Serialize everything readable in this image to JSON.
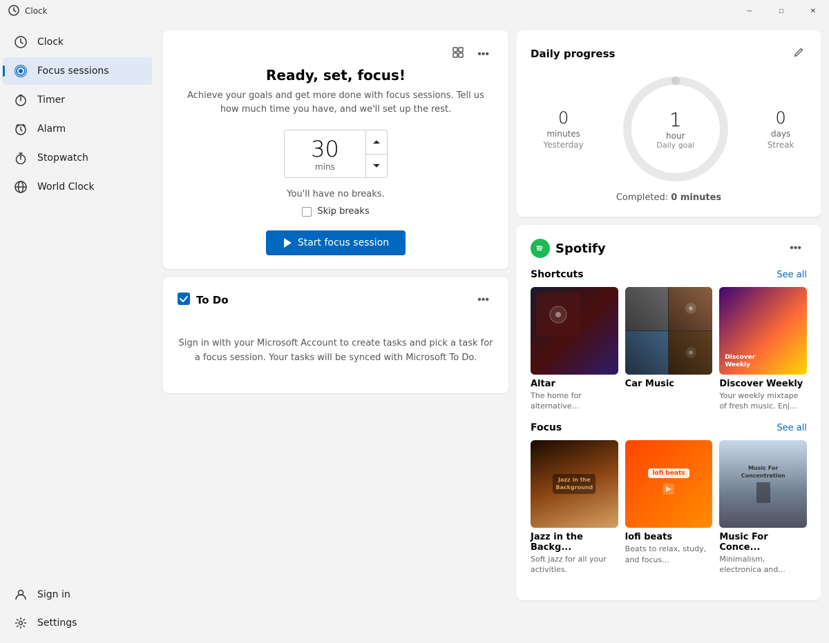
{
  "titlebar": {
    "title": "Clock",
    "minimize_label": "─",
    "maximize_label": "□",
    "close_label": "✕"
  },
  "sidebar": {
    "items": [
      {
        "id": "clock",
        "label": "Clock",
        "icon": "clock"
      },
      {
        "id": "focus",
        "label": "Focus sessions",
        "icon": "focus",
        "active": true
      },
      {
        "id": "timer",
        "label": "Timer",
        "icon": "timer"
      },
      {
        "id": "alarm",
        "label": "Alarm",
        "icon": "alarm"
      },
      {
        "id": "stopwatch",
        "label": "Stopwatch",
        "icon": "stopwatch"
      },
      {
        "id": "worldclock",
        "label": "World Clock",
        "icon": "world"
      }
    ],
    "bottom_items": [
      {
        "id": "signin",
        "label": "Sign in",
        "icon": "person"
      },
      {
        "id": "settings",
        "label": "Settings",
        "icon": "settings"
      }
    ]
  },
  "focus_card": {
    "title": "Ready, set, focus!",
    "subtitle": "Achieve your goals and get more done with focus sessions. Tell us how much time you have, and we'll set up the rest.",
    "time_value": "30",
    "time_unit": "mins",
    "breaks_text": "You'll have no breaks.",
    "skip_breaks_label": "Skip breaks",
    "start_button_label": "Start focus session"
  },
  "todo_card": {
    "title": "To Do",
    "body": "Sign in with your Microsoft Account to create tasks and pick a task for a focus session. Your tasks will be synced with Microsoft To Do."
  },
  "daily_progress": {
    "title": "Daily progress",
    "yesterday_label": "Yesterday",
    "yesterday_value": "0",
    "yesterday_unit": "minutes",
    "daily_goal_label": "Daily goal",
    "daily_goal_value": "1",
    "daily_goal_unit": "hour",
    "streak_label": "Streak",
    "streak_value": "0",
    "streak_unit": "days",
    "completed_text": "Completed: ",
    "completed_value": "0 minutes"
  },
  "spotify": {
    "name": "Spotify",
    "shortcuts_label": "Shortcuts",
    "see_all_shortcuts": "See all",
    "focus_label": "Focus",
    "see_all_focus": "See all",
    "shortcuts": [
      {
        "name": "Altar",
        "desc": "The home for alternative..."
      },
      {
        "name": "Car Music",
        "desc": ""
      },
      {
        "name": "Discover Weekly",
        "desc": "Your weekly mixtape of fresh music. Enj..."
      }
    ],
    "focus_playlists": [
      {
        "name": "Jazz in the Backg...",
        "desc": "Soft jazz for all your activities."
      },
      {
        "name": "lofi beats",
        "desc": "Beats to relax, study, and focus..."
      },
      {
        "name": "Music For Conce...",
        "desc": "Minimalism, electronica and..."
      }
    ]
  }
}
